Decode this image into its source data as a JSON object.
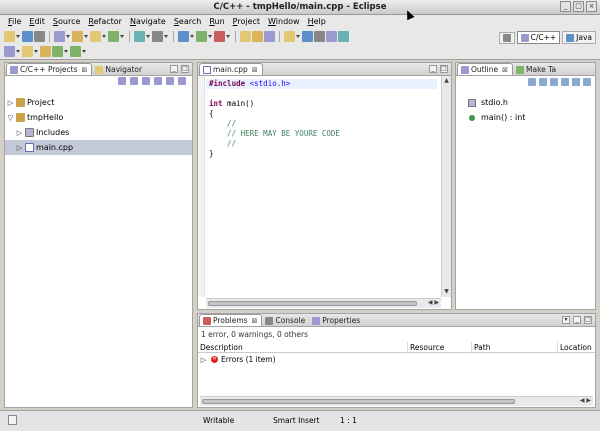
{
  "window": {
    "title": "C/C++ - tmpHello/main.cpp - Eclipse"
  },
  "menubar": {
    "items": [
      {
        "mnemonic": "F",
        "rest": "ile"
      },
      {
        "mnemonic": "E",
        "rest": "dit"
      },
      {
        "mnemonic": "S",
        "rest": "ource"
      },
      {
        "mnemonic": "R",
        "rest": "efactor"
      },
      {
        "mnemonic": "N",
        "rest": "avigate"
      },
      {
        "mnemonic": "S",
        "rest": "earch"
      },
      {
        "mnemonic": "R",
        "rest": "un"
      },
      {
        "mnemonic": "P",
        "rest": "roject"
      },
      {
        "mnemonic": "W",
        "rest": "indow"
      },
      {
        "mnemonic": "H",
        "rest": "elp"
      }
    ]
  },
  "perspectives": {
    "cpp": "C/C++",
    "java": "Java"
  },
  "left_view": {
    "tabs": {
      "projects": "C/C++ Projects",
      "navigator": "Navigator"
    },
    "tree": {
      "project": "Project",
      "tmphello": "tmpHello",
      "includes": "Includes",
      "main": "main.cpp"
    }
  },
  "editor": {
    "tab": "main.cpp",
    "lines": {
      "l1_kw": "#include",
      "l1_rest": " <stdio.h>",
      "l3_kw": "int",
      "l3_rest": " main()",
      "l4": "{",
      "l5": "    //",
      "l6": "    // HERE MAY BE YOURE CODE",
      "l7": "    //",
      "l8": "}"
    }
  },
  "outline_view": {
    "tabs": {
      "outline": "Outline",
      "make": "Make Ta"
    },
    "items": {
      "include": "stdio.h",
      "function": "main() : int"
    }
  },
  "bottom_view": {
    "tabs": {
      "problems": "Problems",
      "console": "Console",
      "properties": "Properties"
    },
    "summary": "1 error, 0 warnings, 0 others",
    "columns": {
      "description": "Description",
      "resource": "Resource",
      "path": "Path",
      "location": "Location"
    },
    "rows": {
      "errors": "Errors (1 item)"
    }
  },
  "statusbar": {
    "writable": "Writable",
    "insert_mode": "Smart Insert",
    "position": "1 : 1"
  },
  "colors": {
    "keyword": "#7f0055",
    "comment": "#3f7f5f",
    "include_string": "#2a00ff",
    "selection": "#c3c9d8",
    "error": "#dd2222"
  }
}
